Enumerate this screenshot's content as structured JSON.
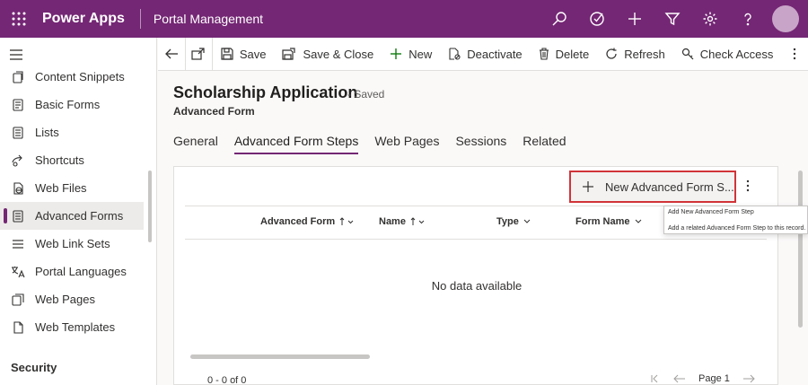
{
  "header": {
    "app_name": "Power Apps",
    "environment": "Portal Management",
    "icons": [
      "search-icon",
      "target-icon",
      "add-icon",
      "filter-icon",
      "settings-icon",
      "help-icon"
    ]
  },
  "sidebar": {
    "items": [
      {
        "label": "Content Snippets",
        "icon": "snippet-icon"
      },
      {
        "label": "Basic Forms",
        "icon": "form-icon"
      },
      {
        "label": "Lists",
        "icon": "list-icon"
      },
      {
        "label": "Shortcuts",
        "icon": "shortcut-icon"
      },
      {
        "label": "Web Files",
        "icon": "web-file-icon"
      },
      {
        "label": "Advanced Forms",
        "icon": "advanced-form-icon",
        "selected": true
      },
      {
        "label": "Web Link Sets",
        "icon": "link-set-icon"
      },
      {
        "label": "Portal Languages",
        "icon": "language-icon"
      },
      {
        "label": "Web Pages",
        "icon": "web-page-icon"
      },
      {
        "label": "Web Templates",
        "icon": "template-icon"
      }
    ],
    "section": "Security"
  },
  "commandbar": {
    "save": "Save",
    "save_close": "Save & Close",
    "new": "New",
    "deactivate": "Deactivate",
    "delete": "Delete",
    "refresh": "Refresh",
    "check_access": "Check Access"
  },
  "record": {
    "title": "Scholarship Application",
    "status": "- Saved",
    "entity": "Advanced Form"
  },
  "tabs": [
    {
      "label": "General"
    },
    {
      "label": "Advanced Form Steps",
      "active": true
    },
    {
      "label": "Web Pages"
    },
    {
      "label": "Sessions"
    },
    {
      "label": "Related"
    }
  ],
  "grid": {
    "new_button": "New Advanced Form S...",
    "columns": [
      "Advanced Form",
      "Name",
      "Type",
      "Form Name"
    ],
    "empty_text": "No data available",
    "record_count": "0 - 0 of 0",
    "page": "Page 1"
  },
  "tooltip": {
    "title": "Add New Advanced Form Step",
    "description": "Add a related Advanced Form Step to this record."
  },
  "colors": {
    "brand": "#742774",
    "highlight_border": "#d13438"
  }
}
